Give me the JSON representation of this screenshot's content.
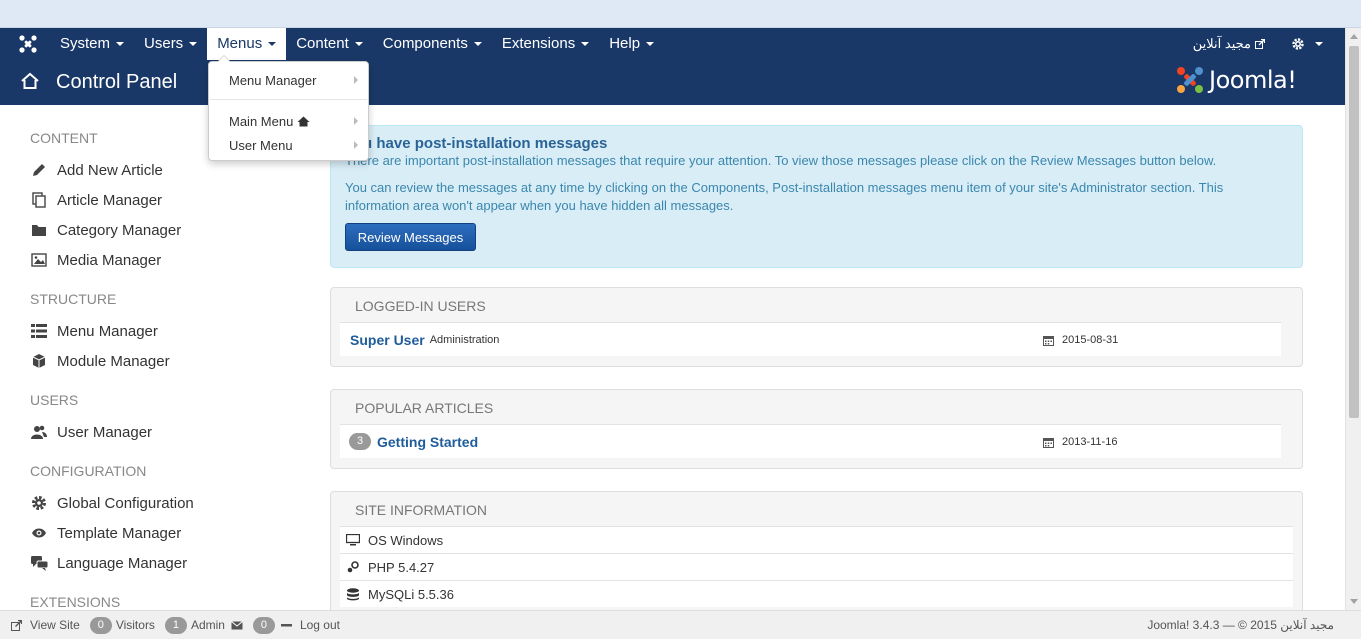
{
  "navbar": {
    "logo_icon": "joomla-icon",
    "menus": [
      {
        "label": "System"
      },
      {
        "label": "Users"
      },
      {
        "label": "Menus"
      },
      {
        "label": "Content"
      },
      {
        "label": "Components"
      },
      {
        "label": "Extensions"
      },
      {
        "label": "Help"
      }
    ],
    "site_name": "مجید آنلاین",
    "settings_icon": "gear-icon"
  },
  "header": {
    "title": "Control Panel",
    "brand": "Joomla!"
  },
  "dropdown": {
    "items": [
      {
        "label": "Menu Manager"
      },
      {
        "label": "Main Menu"
      },
      {
        "label": "User Menu"
      }
    ]
  },
  "sidebar": {
    "sections": [
      {
        "heading": "CONTENT",
        "items": [
          {
            "label": "Add New Article",
            "icon": "pencil-icon"
          },
          {
            "label": "Article Manager",
            "icon": "copy-icon"
          },
          {
            "label": "Category Manager",
            "icon": "folder-icon"
          },
          {
            "label": "Media Manager",
            "icon": "image-icon"
          }
        ]
      },
      {
        "heading": "STRUCTURE",
        "items": [
          {
            "label": "Menu Manager",
            "icon": "list-icon"
          },
          {
            "label": "Module Manager",
            "icon": "cube-icon"
          }
        ]
      },
      {
        "heading": "USERS",
        "items": [
          {
            "label": "User Manager",
            "icon": "users-icon"
          }
        ]
      },
      {
        "heading": "CONFIGURATION",
        "items": [
          {
            "label": "Global Configuration",
            "icon": "cog-icon"
          },
          {
            "label": "Template Manager",
            "icon": "eye-icon"
          },
          {
            "label": "Language Manager",
            "icon": "comments-icon"
          }
        ]
      },
      {
        "heading": "EXTENSIONS",
        "items": []
      }
    ]
  },
  "alert": {
    "title": "You have post-installation messages",
    "paragraph1": "There are important post-installation messages that require your attention. To view those messages please click on the Review Messages button below.",
    "paragraph2": "You can review the messages at any time by clicking on the Components, Post-installation messages menu item of your site's Administrator section. This information area won't appear when you have hidden all messages.",
    "button": "Review Messages"
  },
  "logged_in": {
    "heading": "LOGGED-IN USERS",
    "user": "Super User",
    "location": "Administration",
    "date": "2015-08-31"
  },
  "popular": {
    "heading": "POPULAR ARTICLES",
    "hits": "3",
    "title": "Getting Started",
    "date": "2013-11-16"
  },
  "site_info": {
    "heading": "SITE INFORMATION",
    "rows": [
      {
        "label": "OS Windows",
        "icon": "desktop-icon"
      },
      {
        "label": "PHP 5.4.27",
        "icon": "php-icon"
      },
      {
        "label": "MySQLi 5.5.36",
        "icon": "database-icon"
      }
    ]
  },
  "statusbar": {
    "view_site": "View Site",
    "visitors_count": "0",
    "visitors_label": "Visitors",
    "admin_count": "1",
    "admin_label": "Admin",
    "messages_count": "0",
    "logout": "Log out",
    "copyright": "Joomla! 3.4.3 — © 2015 مجید آنلاین"
  }
}
